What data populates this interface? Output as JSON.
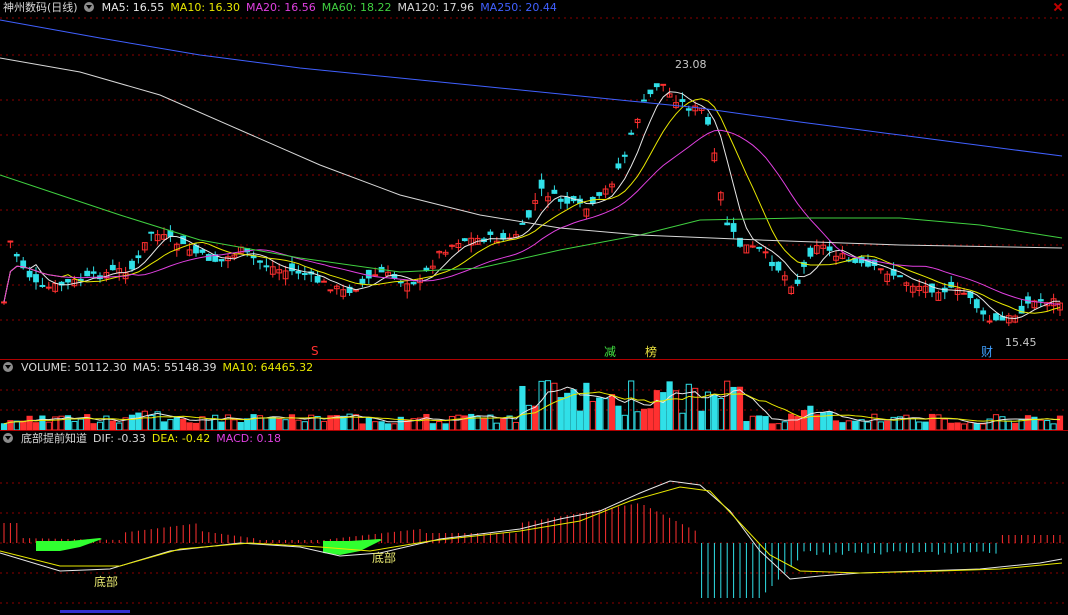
{
  "price_panel": {
    "stock_title": "神州数码(日线)",
    "ma": [
      {
        "label": "MA5: 16.55",
        "color": "#e8e8e8"
      },
      {
        "label": "MA10: 16.30",
        "color": "#e8e800"
      },
      {
        "label": "MA20: 16.56",
        "color": "#e040e0"
      },
      {
        "label": "MA60: 18.22",
        "color": "#40d040"
      },
      {
        "label": "MA120: 17.96",
        "color": "#d8d8d8"
      },
      {
        "label": "MA250: 20.44",
        "color": "#4060ff"
      }
    ],
    "high_label": "23.08",
    "low_label": "15.45",
    "tags": [
      {
        "text": "S",
        "color": "#ff3030"
      },
      {
        "text": "减",
        "color": "#40e040"
      },
      {
        "text": "榜",
        "color": "#e8e040"
      },
      {
        "text": "财",
        "color": "#40a0ff"
      }
    ]
  },
  "volume_panel": {
    "volume": "VOLUME: 50112.30",
    "ma5": "MA5: 55148.39",
    "ma10": "MA10: 64465.32"
  },
  "macd_panel": {
    "name": "底部提前知道",
    "dif": "DIF: -0.33",
    "dea": "DEA: -0.42",
    "macd": "MACD: 0.18",
    "bottom_label_1": "底部",
    "bottom_label_2": "底部"
  },
  "colors": {
    "up": "#ff3030",
    "down": "#30e0e8",
    "grid": "#8c0000",
    "ma5": "#e8e8e8",
    "ma10": "#e8e800",
    "ma20": "#e040e0",
    "ma60": "#40d040",
    "ma120": "#d8d8d8",
    "ma250": "#4060ff",
    "bottom_signal": "#30ff30"
  }
}
